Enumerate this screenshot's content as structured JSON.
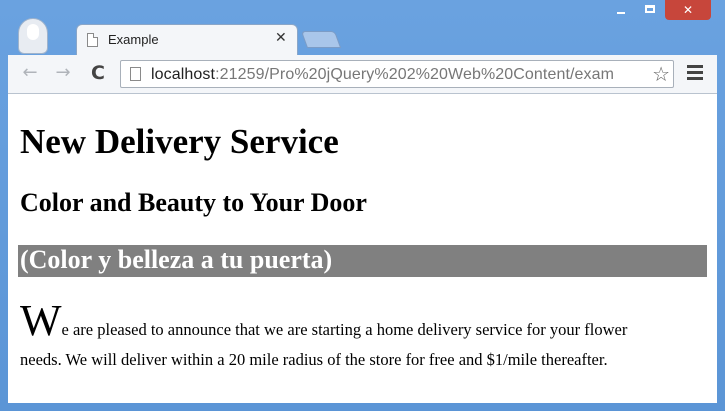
{
  "window": {
    "minimize_icon": "minimize-icon",
    "maximize_icon": "maximize-icon",
    "close_label": "✕"
  },
  "tab": {
    "title": "Example",
    "close_label": "✕"
  },
  "toolbar": {
    "back_label": "←",
    "forward_label": "→",
    "reload_label": "C",
    "url_host": "localhost",
    "url_rest": ":21259/Pro%20jQuery%202%20Web%20Content/exam",
    "star_label": "☆"
  },
  "page": {
    "heading": "New Delivery Service",
    "subheading": "Color and Beauty to Your Door",
    "subheading_translated": "(Color y belleza a tu puerta)",
    "drop_cap": "W",
    "paragraph_line1": "e are pleased to announce that we are starting a home delivery service for your flower",
    "paragraph_line2": "needs. We will deliver within a 20 mile radius of the store for free and $1/mile thereafter."
  },
  "colors": {
    "band_bg": "#808080",
    "close_button": "#c7463b",
    "frame": "#5b95d6"
  }
}
